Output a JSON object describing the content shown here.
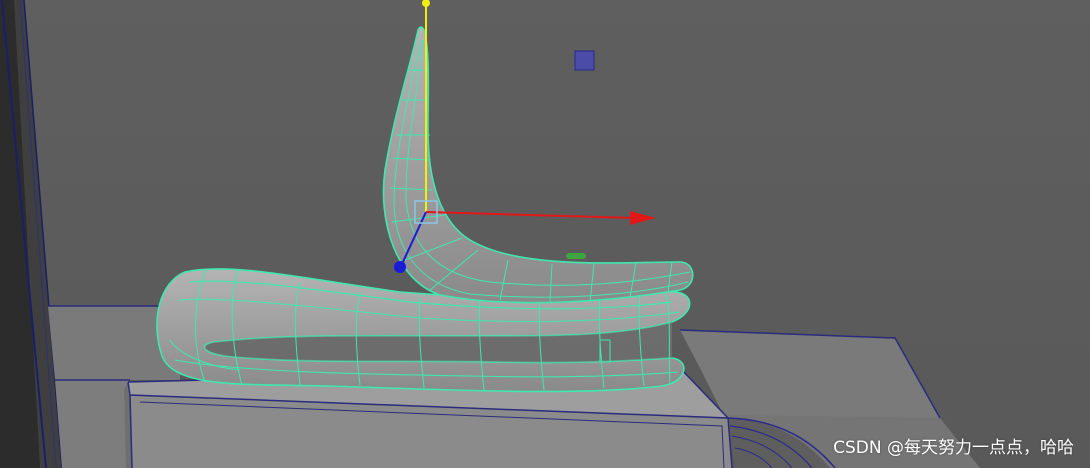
{
  "viewport": {
    "background": "#5d5d5d",
    "wireframe_color": "#3fe8b0",
    "axis_x_color": "#e01818",
    "axis_y_color": "#f2ee10",
    "axis_z_color": "#1a1ad8"
  },
  "watermark": {
    "text": "CSDN @每天努力一点点，哈哈",
    "color": "#ffffff"
  },
  "manipulator": {
    "type": "move-tool",
    "axes": [
      "x",
      "y",
      "z"
    ]
  },
  "icons": [
    "move-manipulator-icon",
    "center-handle-icon"
  ]
}
